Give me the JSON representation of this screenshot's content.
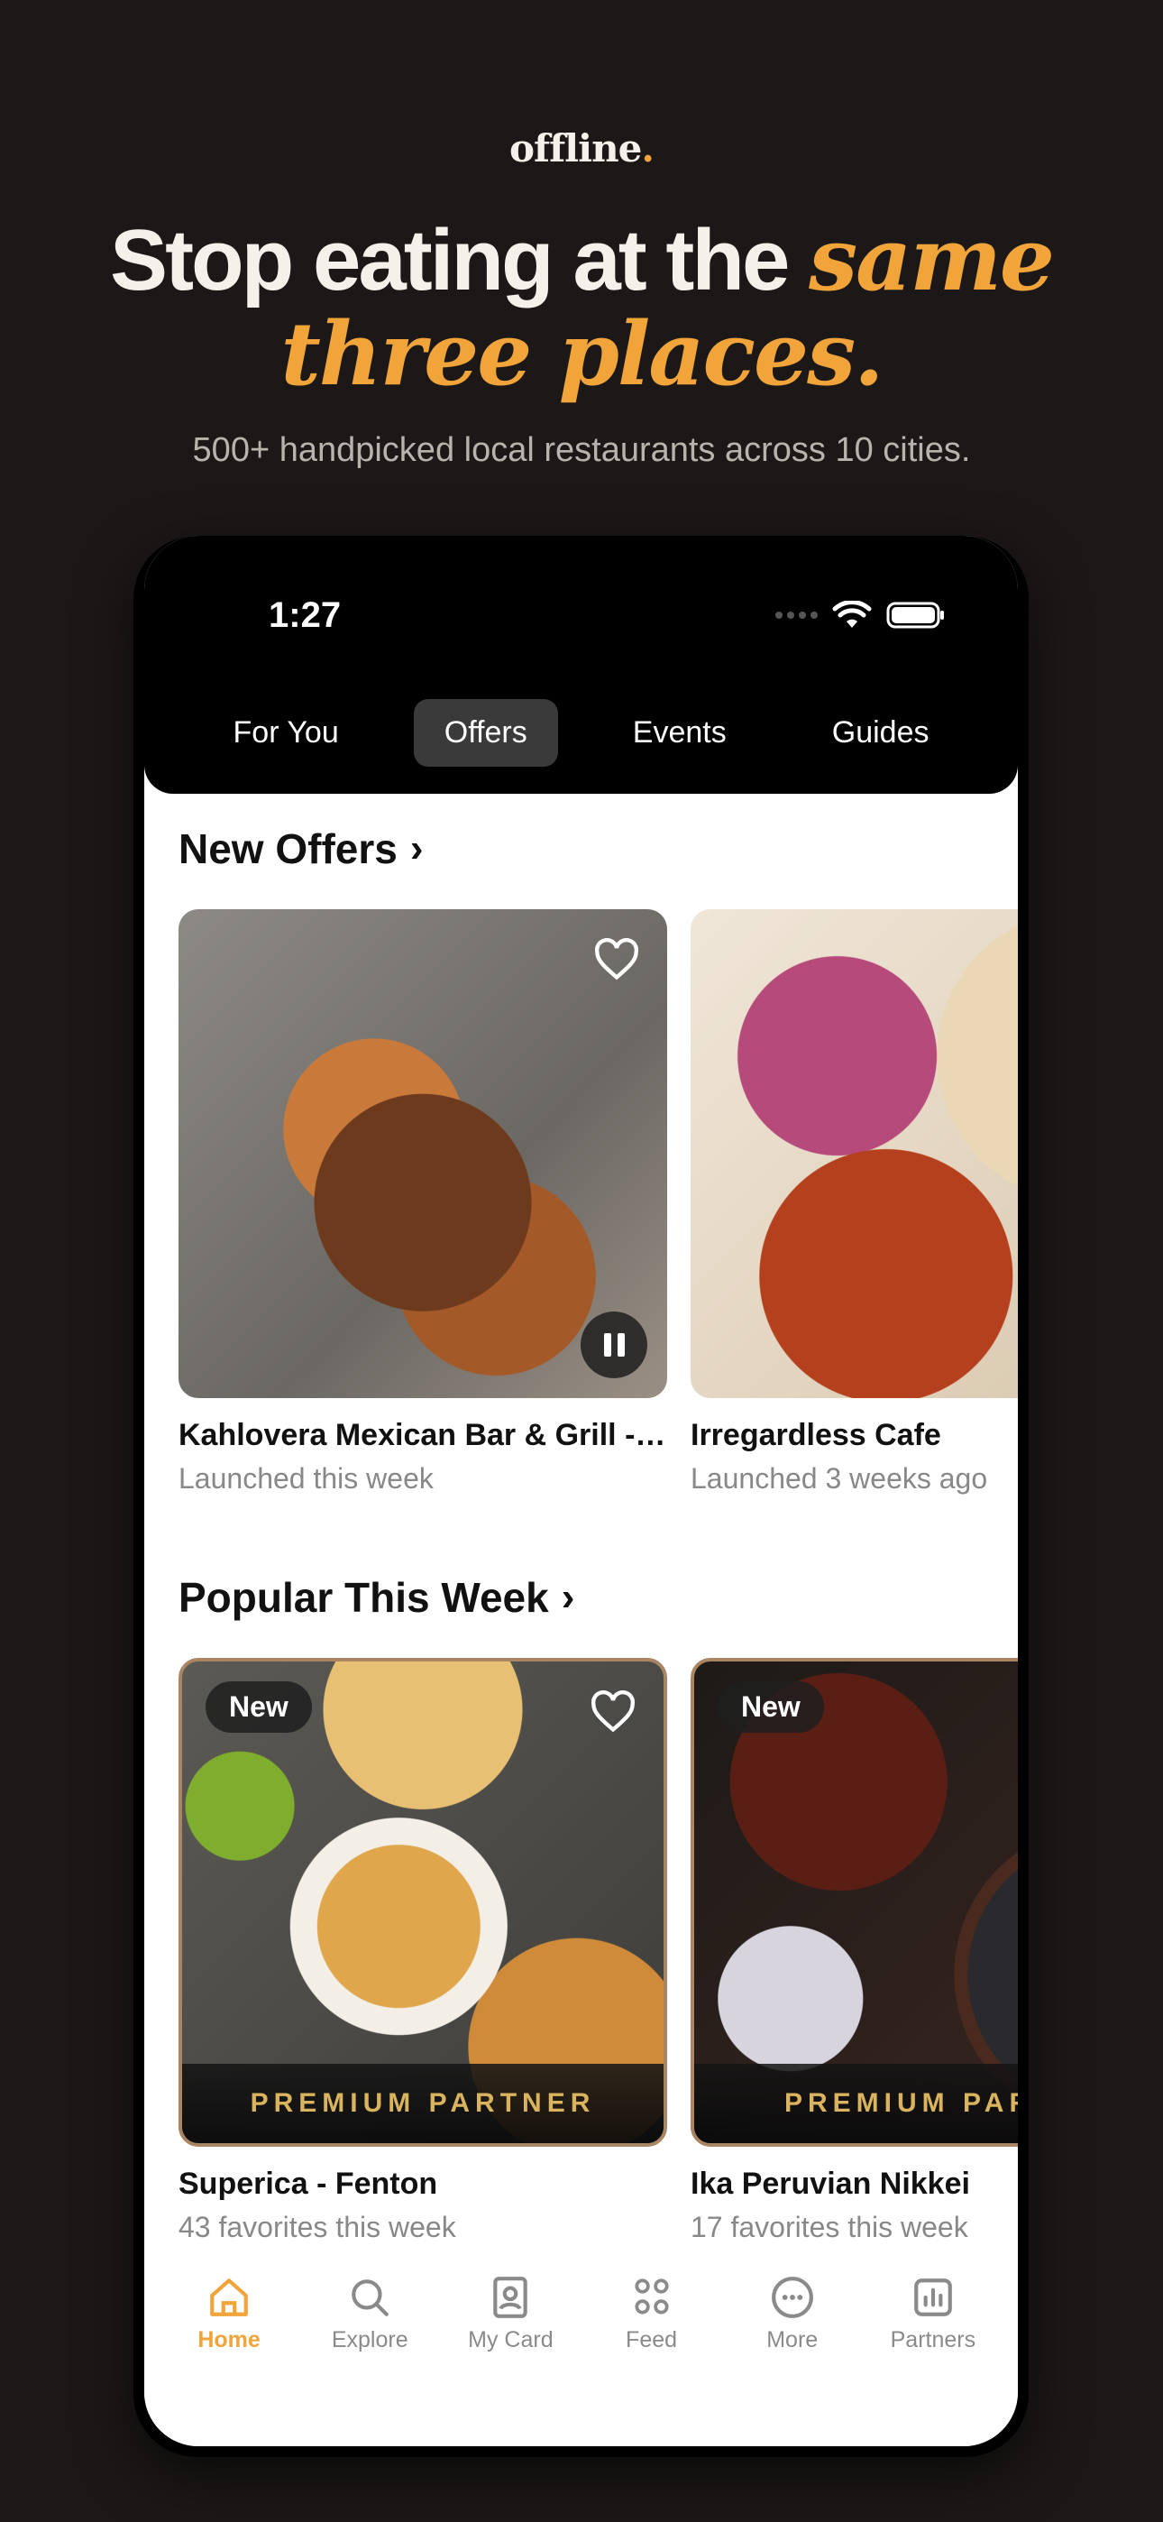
{
  "brand": {
    "name": "offline",
    "dot": "."
  },
  "headline": {
    "line1": "Stop eating at the ",
    "accent1": "same",
    "accent2": "three places."
  },
  "subhead": "500+ handpicked local restaurants across 10 cities.",
  "status": {
    "time": "1:27"
  },
  "tabs": [
    {
      "label": "For You",
      "active": false
    },
    {
      "label": "Offers",
      "active": true
    },
    {
      "label": "Events",
      "active": false
    },
    {
      "label": "Guides",
      "active": false
    }
  ],
  "new_offers": {
    "title": "New Offers",
    "cards": [
      {
        "name": "Kahlovera Mexican Bar & Grill - ...",
        "sub": "Launched this week"
      },
      {
        "name": "Irregardless Cafe",
        "sub": "Launched 3 weeks ago"
      }
    ]
  },
  "popular": {
    "title": "Popular This Week",
    "cards": [
      {
        "badge": "New",
        "premium": "PREMIUM PARTNER",
        "name": "Superica - Fenton",
        "sub": "43 favorites this week"
      },
      {
        "badge": "New",
        "premium": "PREMIUM PARTNER",
        "name": "Ika Peruvian Nikkei",
        "sub": "17 favorites this week"
      }
    ]
  },
  "nav": [
    {
      "label": "Home",
      "icon": "home-icon",
      "active": true
    },
    {
      "label": "Explore",
      "icon": "search-icon",
      "active": false
    },
    {
      "label": "My Card",
      "icon": "card-icon",
      "active": false
    },
    {
      "label": "Feed",
      "icon": "people-icon",
      "active": false
    },
    {
      "label": "More",
      "icon": "more-icon",
      "active": false
    },
    {
      "label": "Partners",
      "icon": "chart-icon",
      "active": false
    }
  ],
  "colors": {
    "accent": "#f0a43a",
    "background": "#1c1817",
    "premium_gold": "#d9b35e"
  }
}
